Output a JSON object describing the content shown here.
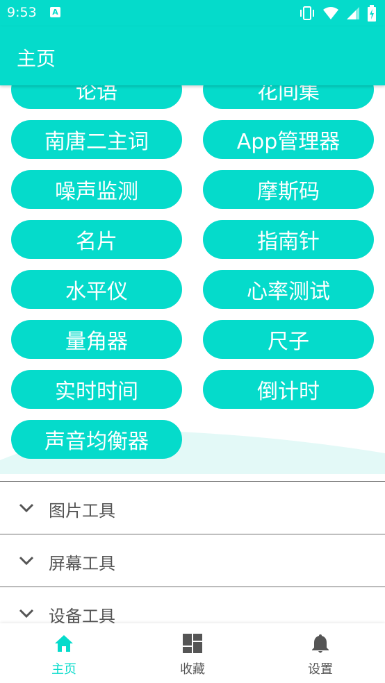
{
  "status": {
    "time": "9:53",
    "notification_icon": "A"
  },
  "app_bar": {
    "title": "主页"
  },
  "tools": [
    "论语",
    "花间集",
    "南唐二主词",
    "App管理器",
    "噪声监测",
    "摩斯码",
    "名片",
    "指南针",
    "水平仪",
    "心率测试",
    "量角器",
    "尺子",
    "实时时间",
    "倒计时",
    "声音均衡器"
  ],
  "sections": [
    "图片工具",
    "屏幕工具",
    "设备工具"
  ],
  "bottom_nav": {
    "home": "主页",
    "favorites": "收藏",
    "settings": "设置"
  },
  "colors": {
    "accent": "#05dbcb",
    "text_gray": "#555555"
  }
}
